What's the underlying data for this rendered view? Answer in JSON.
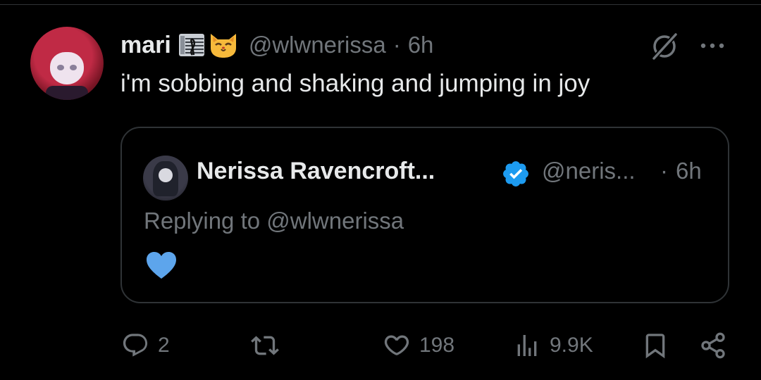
{
  "tweet": {
    "author": {
      "name": "mari",
      "emoji": [
        "musical-score-emoji",
        "cat-face-emoji"
      ],
      "handle": "@wlwnerissa",
      "time": "6h"
    },
    "text": "i'm sobbing and shaking and jumping in joy"
  },
  "quote": {
    "author": {
      "name": "Nerissa Ravencroft...",
      "handle": "@neris...",
      "time": "6h",
      "verified": true
    },
    "replying_prefix": "Replying to ",
    "replying_handle": "@wlwnerissa",
    "body_emoji": "blue-heart-emoji"
  },
  "separator": "·",
  "actions": {
    "replies": "2",
    "reposts": "",
    "likes": "198",
    "views": "9.9K"
  },
  "colors": {
    "background": "#000000",
    "text": "#e7e9ea",
    "muted": "#71767b",
    "border": "#2f3336",
    "verified": "#1d9bf0",
    "heart": "#5da5ec"
  }
}
